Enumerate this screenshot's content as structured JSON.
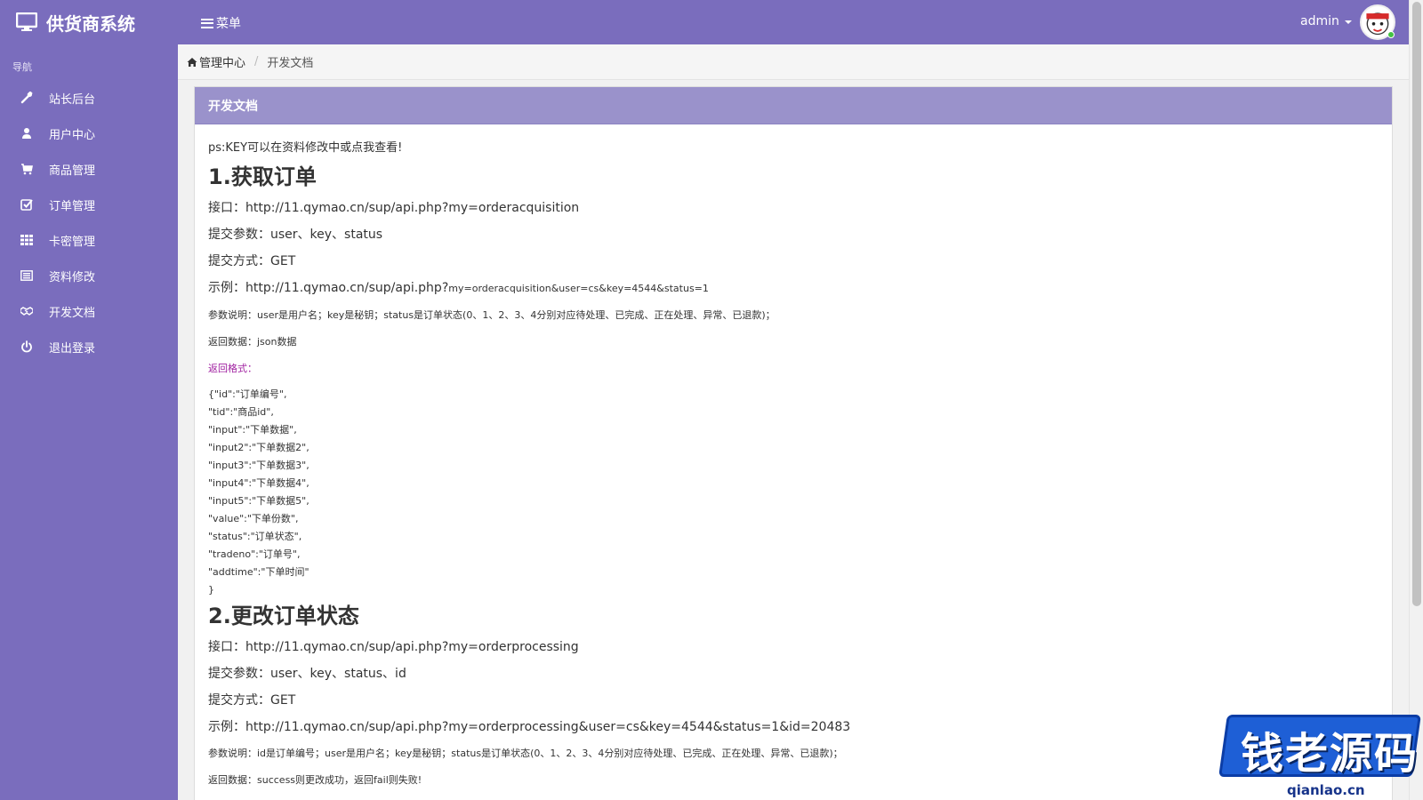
{
  "header": {
    "brand": "供货商系统",
    "menu_label": "菜单",
    "username": "admin"
  },
  "sidebar": {
    "nav_header": "导航",
    "items": [
      {
        "label": "站长后台",
        "icon": "wrench-icon"
      },
      {
        "label": "用户中心",
        "icon": "user-icon"
      },
      {
        "label": "商品管理",
        "icon": "cart-icon"
      },
      {
        "label": "订单管理",
        "icon": "check-square-icon"
      },
      {
        "label": "卡密管理",
        "icon": "grid-icon"
      },
      {
        "label": "资料修改",
        "icon": "list-alt-icon"
      },
      {
        "label": "开发文档",
        "icon": "handshake-icon"
      },
      {
        "label": "退出登录",
        "icon": "power-icon"
      }
    ]
  },
  "breadcrumb": {
    "home": "管理中心",
    "current": "开发文档"
  },
  "panel": {
    "title": "开发文档",
    "ps": "ps:KEY可以在资料修改中或点我查看!",
    "section1": {
      "title": "1.获取订单",
      "api_prefix": "接口：",
      "api_url": "http://11.qymao.cn/sup/api.php?my=orderacquisition",
      "params": "提交参数：user、key、status",
      "method": "提交方式：GET",
      "example_prefix": "示例：",
      "example_url_a": "http://11.qymao.cn/sup/api.php?",
      "example_url_b": "my=orderacquisition&user=cs&key=4544&status=1",
      "explain": "参数说明：user是用户名；key是秘钥；status是订单状态(0、1、2、3、4分别对应待处理、已完成、正在处理、异常、已退款)；",
      "returns": "返回数据：json数据",
      "format_label": "返回格式：",
      "format_lines": [
        "{\"id\":\"订单编号\",",
        "\"tid\":\"商品id\",",
        "\"input\":\"下单数据\",",
        "\"input2\":\"下单数据2\",",
        "\"input3\":\"下单数据3\",",
        "\"input4\":\"下单数据4\",",
        "\"input5\":\"下单数据5\",",
        "\"value\":\"下单份数\",",
        "\"status\":\"订单状态\",",
        "\"tradeno\":\"订单号\",",
        "\"addtime\":\"下单时间\"",
        "}"
      ]
    },
    "section2": {
      "title": "2.更改订单状态",
      "api_prefix": "接口：",
      "api_url": "http://11.qymao.cn/sup/api.php?my=orderprocessing",
      "params": "提交参数：user、key、status、id",
      "method": "提交方式：GET",
      "example_prefix": "示例：",
      "example_url": "http://11.qymao.cn/sup/api.php?my=orderprocessing&user=cs&key=4544&status=1&id=20483",
      "explain": "参数说明：id是订单编号；user是用户名；key是秘钥；status是订单状态(0、1、2、3、4分别对应待处理、已完成、正在处理、异常、已退款)；",
      "returns": "返回数据：success则更改成功，返回fail则失败!"
    }
  },
  "watermark": {
    "text": "钱老源码",
    "domain": "qianlao.cn"
  },
  "colors": {
    "accent": "#7a6dbd",
    "panel_heading": "#9a92cb",
    "format_label": "#a020a0"
  }
}
